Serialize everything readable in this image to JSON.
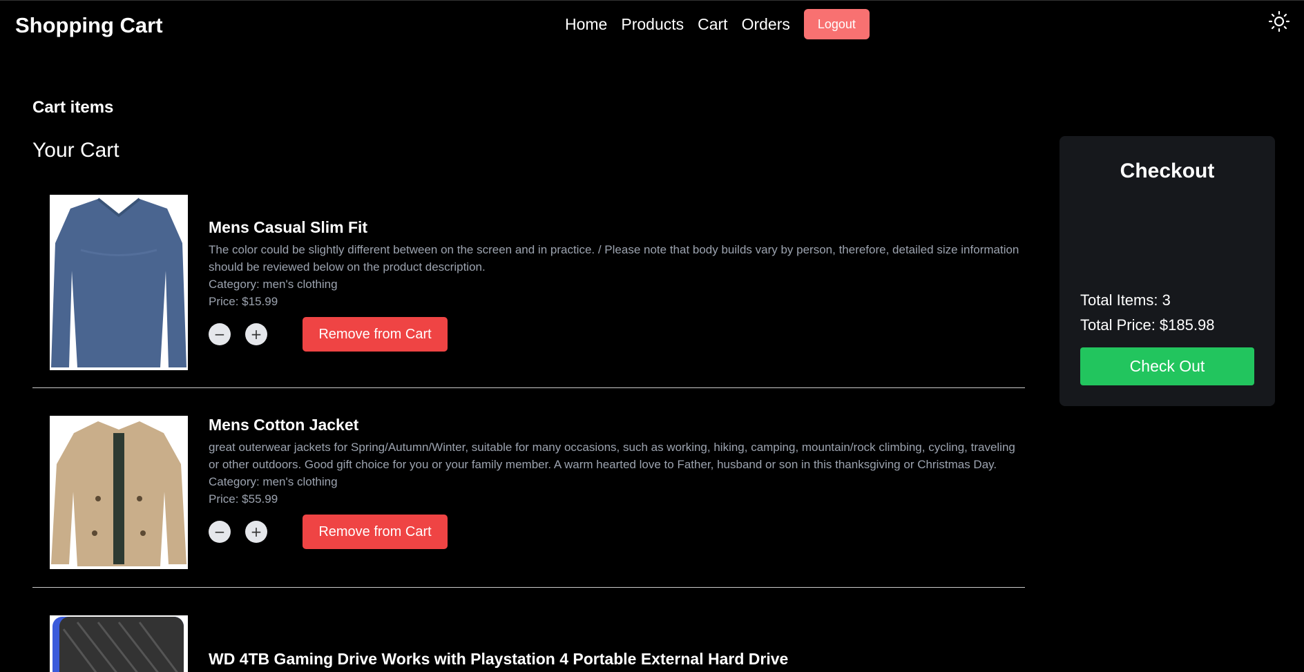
{
  "header": {
    "brand": "Shopping Cart",
    "nav": [
      "Home",
      "Products",
      "Cart",
      "Orders"
    ],
    "logout_label": "Logout"
  },
  "page": {
    "section_title": "Cart items",
    "cart_heading": "Your Cart"
  },
  "cart_items": [
    {
      "name": "Mens Casual Slim Fit",
      "description": "The color could be slightly different between on the screen and in practice. / Please note that body builds vary by person, therefore, detailed size information should be reviewed below on the product description.",
      "category": "Category: men's clothing",
      "price": "Price: $15.99",
      "decrement": "−",
      "increment": "+",
      "remove_label": "Remove from Cart"
    },
    {
      "name": "Mens Cotton Jacket",
      "description": "great outerwear jackets for Spring/Autumn/Winter, suitable for many occasions, such as working, hiking, camping, mountain/rock climbing, cycling, traveling or other outdoors. Good gift choice for you or your family member. A warm hearted love to Father, husband or son in this thanksgiving or Christmas Day.",
      "category": "Category: men's clothing",
      "price": "Price: $55.99",
      "decrement": "−",
      "increment": "+",
      "remove_label": "Remove from Cart"
    },
    {
      "name": "WD 4TB Gaming Drive Works with Playstation 4 Portable External Hard Drive"
    }
  ],
  "checkout": {
    "title": "Checkout",
    "total_items": "Total Items: 3",
    "total_price": "Total Price: $185.98",
    "button_label": "Check Out"
  },
  "colors": {
    "logout": "#f87171",
    "remove": "#ef4444",
    "checkout": "#22c55e",
    "panel": "#16181c"
  }
}
